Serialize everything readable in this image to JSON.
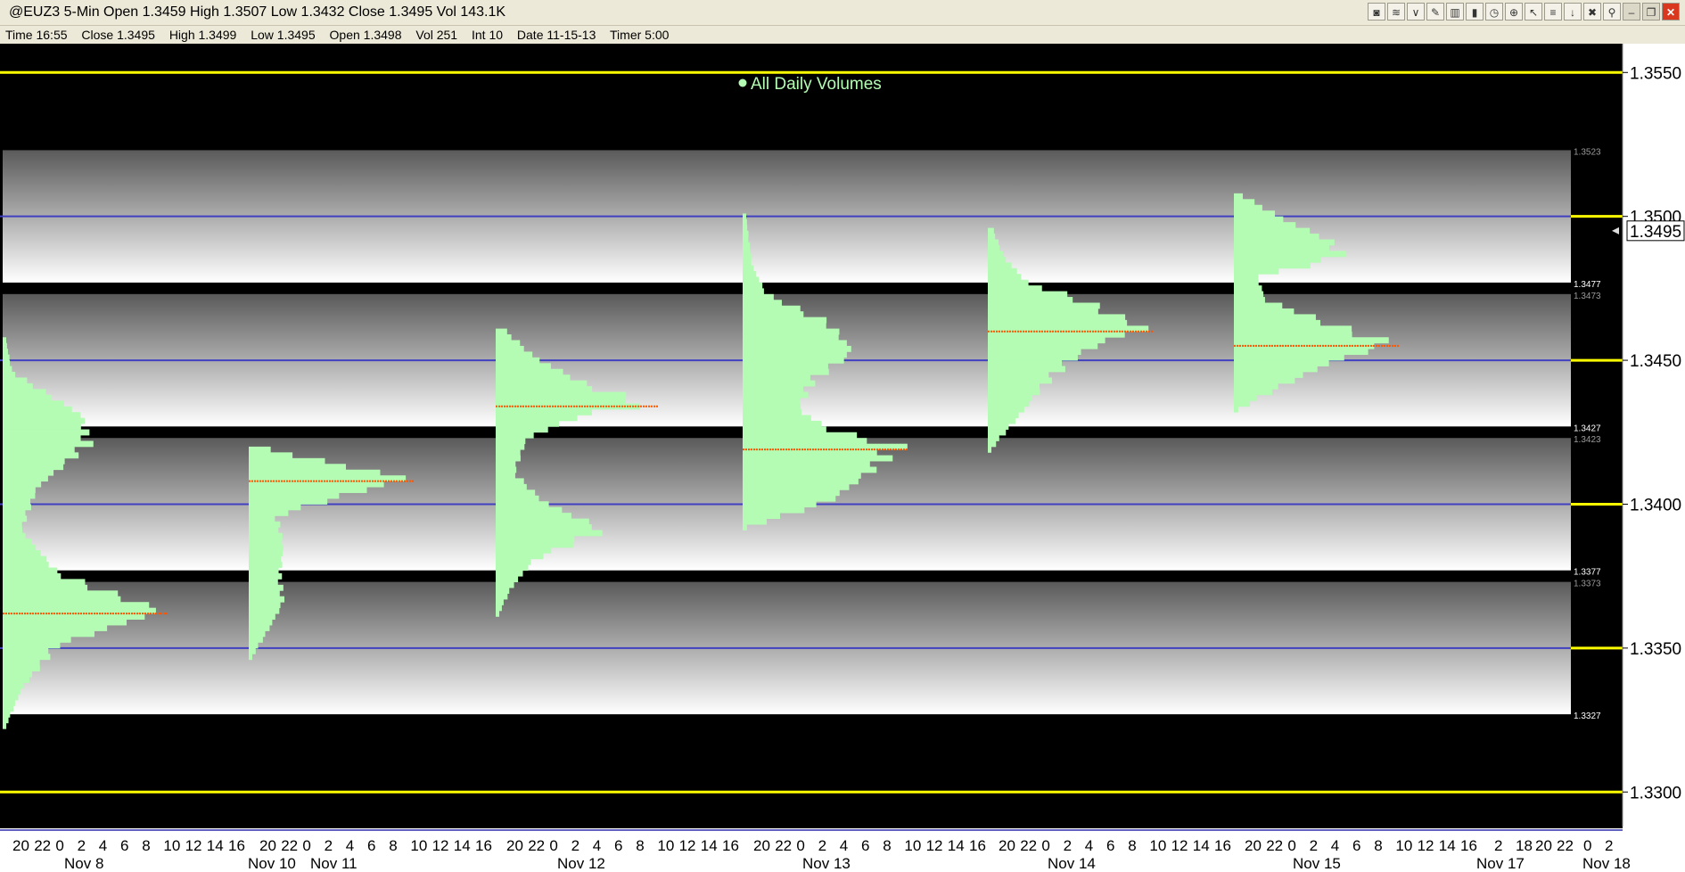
{
  "window": {
    "title": "@EUZ3 5-Min Open 1.3459 High 1.3507 Low 1.3432 Close 1.3495 Vol 143.1K"
  },
  "toolbar": {
    "buttons": [
      {
        "name": "chart-type-icon",
        "glyph": "◙"
      },
      {
        "name": "waves-icon",
        "glyph": "≋"
      },
      {
        "name": "indicator-icon",
        "glyph": "∨"
      },
      {
        "name": "pencil-icon",
        "glyph": "✎"
      },
      {
        "name": "bars-icon",
        "glyph": "▥"
      },
      {
        "name": "candle-icon",
        "glyph": "▮"
      },
      {
        "name": "clock-icon",
        "glyph": "◷"
      },
      {
        "name": "magnify-icon",
        "glyph": "⊕"
      },
      {
        "name": "cursor-icon",
        "glyph": "↖"
      },
      {
        "name": "fib-icon",
        "glyph": "≡"
      },
      {
        "name": "arrow-down-icon",
        "glyph": "↓"
      },
      {
        "name": "trash-icon",
        "glyph": "✖"
      },
      {
        "name": "pin-icon",
        "glyph": "⚲"
      }
    ],
    "window_buttons": [
      {
        "name": "minimize-icon",
        "glyph": "–"
      },
      {
        "name": "restore-icon",
        "glyph": "❐"
      },
      {
        "name": "close-icon",
        "glyph": "✕"
      }
    ]
  },
  "infobar": {
    "time": "Time 16:55",
    "close": "Close 1.3495",
    "high": "High 1.3499",
    "low": "Low 1.3495",
    "open": "Open 1.3498",
    "vol": "Vol 251",
    "int": "Int 10",
    "date": "Date 11-15-13",
    "timer": "Timer 5:00"
  },
  "colors": {
    "background": "#000000",
    "profile": "#b4fcb4",
    "poc": "#ff5500",
    "round_number_line": "#ffff00",
    "grid_line": "#4040c0",
    "axis_text": "#ffffff"
  },
  "chart_data": {
    "type": "volume-profile",
    "legend": "All Daily Volumes",
    "ylim": [
      1.3288,
      1.356
    ],
    "y_ticks": [
      "1.3550",
      "1.3500",
      "1.3450",
      "1.3400",
      "1.3350",
      "1.3300"
    ],
    "y_tick_values": [
      1.355,
      1.35,
      1.345,
      1.34,
      1.335,
      1.33
    ],
    "current_price": {
      "label": "1.3495",
      "value": 1.3495
    },
    "zones": [
      {
        "top": 1.3523,
        "bottom": 1.3477,
        "top_label": "1.3523",
        "bottom_label": "1.3477"
      },
      {
        "top": 1.3473,
        "bottom": 1.3427,
        "top_label": "1.3473",
        "bottom_label": "1.3427"
      },
      {
        "top": 1.3423,
        "bottom": 1.3377,
        "top_label": "1.3423",
        "bottom_label": "1.3377"
      },
      {
        "top": 1.3373,
        "bottom": 1.3327,
        "top_label": "1.3373",
        "bottom_label": "1.3327"
      }
    ],
    "x_hour_ticks": [
      "20",
      "22",
      "0",
      "2",
      "4",
      "6",
      "8",
      "10",
      "12",
      "14",
      "16"
    ],
    "x_day_labels": [
      "Nov 8",
      "Nov 10",
      "Nov 11",
      "Nov 12",
      "Nov 13",
      "Nov 14",
      "Nov 15",
      "Nov 17",
      "Nov 18"
    ],
    "profiles": [
      {
        "day": "Nov 8",
        "low": 1.3322,
        "high": 1.3456,
        "poc": 1.3362,
        "poc_volume": 1.0,
        "nodes": [
          [
            1.3322,
            0.02
          ],
          [
            1.3335,
            0.12
          ],
          [
            1.335,
            0.35
          ],
          [
            1.3362,
            1.0
          ],
          [
            1.3375,
            0.35
          ],
          [
            1.339,
            0.12
          ],
          [
            1.3405,
            0.22
          ],
          [
            1.342,
            0.55
          ],
          [
            1.343,
            0.5
          ],
          [
            1.3445,
            0.06
          ],
          [
            1.3456,
            0.02
          ]
        ]
      },
      {
        "day": "Nov 10",
        "low": 1.3346,
        "high": 1.3419,
        "poc": 1.3408,
        "poc_volume": 1.0,
        "nodes": [
          [
            1.3346,
            0.02
          ],
          [
            1.3355,
            0.12
          ],
          [
            1.3365,
            0.22
          ],
          [
            1.3375,
            0.2
          ],
          [
            1.3385,
            0.22
          ],
          [
            1.3395,
            0.18
          ],
          [
            1.3402,
            0.6
          ],
          [
            1.3408,
            1.0
          ],
          [
            1.3413,
            0.55
          ],
          [
            1.3419,
            0.05
          ]
        ]
      },
      {
        "day": "Nov 12",
        "low": 1.3361,
        "high": 1.346,
        "poc": 1.3434,
        "poc_volume": 1.0,
        "nodes": [
          [
            1.3361,
            0.02
          ],
          [
            1.337,
            0.1
          ],
          [
            1.338,
            0.25
          ],
          [
            1.339,
            0.7
          ],
          [
            1.34,
            0.3
          ],
          [
            1.341,
            0.12
          ],
          [
            1.3422,
            0.2
          ],
          [
            1.343,
            0.55
          ],
          [
            1.3434,
            1.0
          ],
          [
            1.344,
            0.6
          ],
          [
            1.345,
            0.25
          ],
          [
            1.346,
            0.05
          ]
        ]
      },
      {
        "day": "Nov 13",
        "low": 1.3391,
        "high": 1.35,
        "poc": 1.3419,
        "poc_volume": 1.0,
        "nodes": [
          [
            1.3391,
            0.03
          ],
          [
            1.34,
            0.55
          ],
          [
            1.341,
            0.8
          ],
          [
            1.3419,
            1.0
          ],
          [
            1.3425,
            0.55
          ],
          [
            1.3432,
            0.35
          ],
          [
            1.3442,
            0.45
          ],
          [
            1.3452,
            0.7
          ],
          [
            1.3462,
            0.55
          ],
          [
            1.3472,
            0.15
          ],
          [
            1.3482,
            0.06
          ],
          [
            1.35,
            0.02
          ]
        ]
      },
      {
        "day": "Nov 14",
        "low": 1.3418,
        "high": 1.3495,
        "poc": 1.346,
        "poc_volume": 1.0,
        "nodes": [
          [
            1.3418,
            0.02
          ],
          [
            1.343,
            0.2
          ],
          [
            1.344,
            0.35
          ],
          [
            1.345,
            0.55
          ],
          [
            1.3456,
            0.75
          ],
          [
            1.346,
            1.0
          ],
          [
            1.3465,
            0.8
          ],
          [
            1.347,
            0.6
          ],
          [
            1.3476,
            0.25
          ],
          [
            1.3485,
            0.1
          ],
          [
            1.3495,
            0.03
          ]
        ]
      },
      {
        "day": "Nov 15",
        "low": 1.3432,
        "high": 1.3507,
        "poc": 1.3455,
        "poc_volume": 1.0,
        "nodes": [
          [
            1.3432,
            0.03
          ],
          [
            1.344,
            0.3
          ],
          [
            1.3448,
            0.6
          ],
          [
            1.3455,
            1.0
          ],
          [
            1.3462,
            0.6
          ],
          [
            1.347,
            0.2
          ],
          [
            1.3478,
            0.15
          ],
          [
            1.3485,
            0.7
          ],
          [
            1.3491,
            0.6
          ],
          [
            1.3497,
            0.35
          ],
          [
            1.3507,
            0.03
          ]
        ]
      }
    ]
  }
}
